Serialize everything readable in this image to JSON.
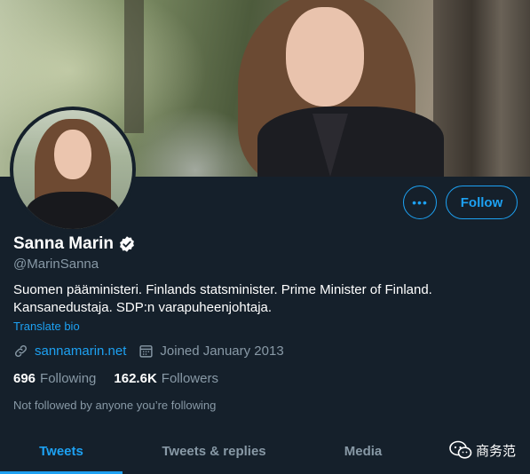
{
  "profile": {
    "name": "Sanna Marin",
    "handle": "@MarinSanna",
    "bio_line1": "Suomen pääministeri. Finlands statsminister. Prime Minister of Finland.",
    "bio_line2": "Kansanedustaja. SDP:n varapuheenjohtaja.",
    "translate_label": "Translate bio",
    "website": "sannamarin.net",
    "joined": "Joined January 2013",
    "following_count": "696",
    "following_label": "Following",
    "followers_count": "162.6K",
    "followers_label": "Followers",
    "not_followed_text": "Not followed by anyone you’re following",
    "verified": true
  },
  "actions": {
    "more_label": "•••",
    "follow_label": "Follow"
  },
  "tabs": [
    {
      "label": "Tweets",
      "active": true
    },
    {
      "label": "Tweets & replies",
      "active": false
    },
    {
      "label": "Media",
      "active": false
    }
  ],
  "watermark": {
    "text": "商务范"
  },
  "icons": {
    "verified": "verified-badge-icon",
    "link": "link-icon",
    "calendar": "calendar-icon",
    "more": "more-dots-icon",
    "watermark": "wechat-icon"
  },
  "colors": {
    "background": "#15202b",
    "accent": "#1da1f2",
    "secondary_text": "#8899a6",
    "primary_text": "#ffffff"
  }
}
